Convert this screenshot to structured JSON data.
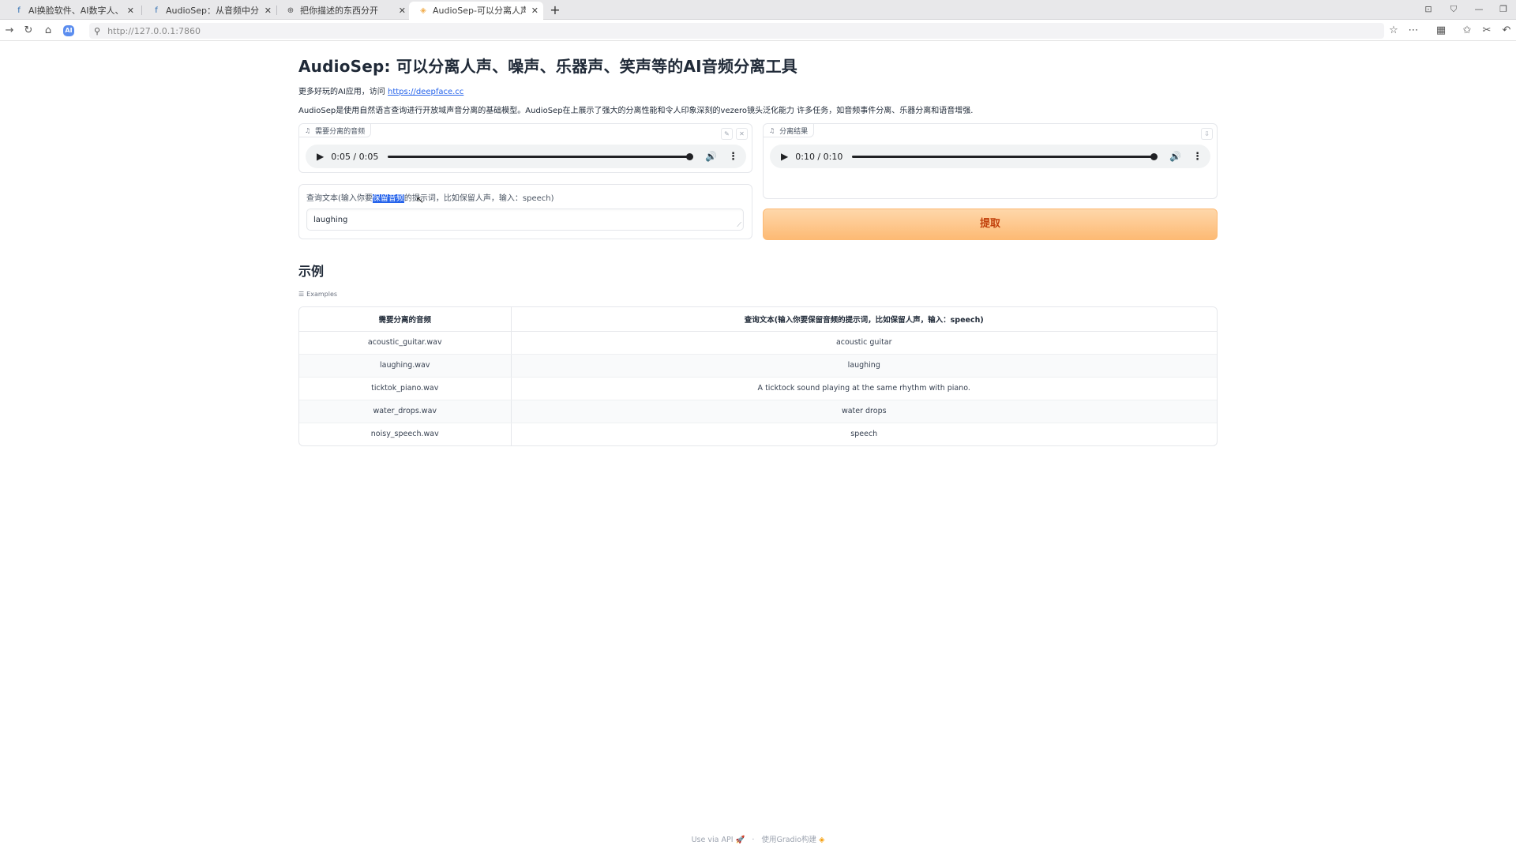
{
  "browser": {
    "tabs": [
      {
        "label": "AI换脸软件、AI数字人、AI创",
        "icon": "facebook-icon"
      },
      {
        "label": "AudioSep：从音频中分离出",
        "icon": "facebook-icon"
      },
      {
        "label": "把你描述的东西分开",
        "icon": "globe-icon"
      },
      {
        "label": "AudioSep-可以分离人声、噪",
        "icon": "gradio-icon",
        "active": true
      }
    ],
    "url": "http://127.0.0.1:7860"
  },
  "header": {
    "title": "AudioSep: 可以分离人声、噪声、乐器声、笑声等的AI音频分离工具",
    "more_prefix": "更多好玩的AI应用，访问",
    "more_link": "https://deepface.cc",
    "description": "AudioSep是使用自然语言查询进行开放域声音分离的基础模型。AudioSep在上展示了强大的分离性能和令人印象深刻的vezero镜头泛化能力 许多任务，如音频事件分离、乐器分离和语音增强."
  },
  "input_audio": {
    "label": "需要分离的音频",
    "time": "0:05 / 0:05"
  },
  "output_audio": {
    "label": "分离结果",
    "time": "0:10 / 0:10"
  },
  "query": {
    "label_before": "查询文本(输入你要",
    "label_selected": "保留音频",
    "label_after": "的提示词，比如保留人声，输入：speech)",
    "value": "laughing"
  },
  "extract_button": {
    "label": "提取"
  },
  "examples": {
    "section_title": "示例",
    "label": "Examples",
    "columns": [
      "需要分离的音频",
      "查询文本(输入你要保留音频的提示词，比如保留人声，输入：speech)"
    ],
    "rows": [
      [
        "acoustic_guitar.wav",
        "acoustic guitar"
      ],
      [
        "laughing.wav",
        "laughing"
      ],
      [
        "ticktok_piano.wav",
        "A ticktock sound playing at the same rhythm with piano."
      ],
      [
        "water_drops.wav",
        "water drops"
      ],
      [
        "noisy_speech.wav",
        "speech"
      ]
    ]
  },
  "footer": {
    "api": "Use via API",
    "dot": "·",
    "built": "使用Gradio构建"
  },
  "colors": {
    "accent": "#fdba74",
    "accent_text": "#c2410c",
    "link": "#2563eb",
    "selection": "#2563eb"
  }
}
